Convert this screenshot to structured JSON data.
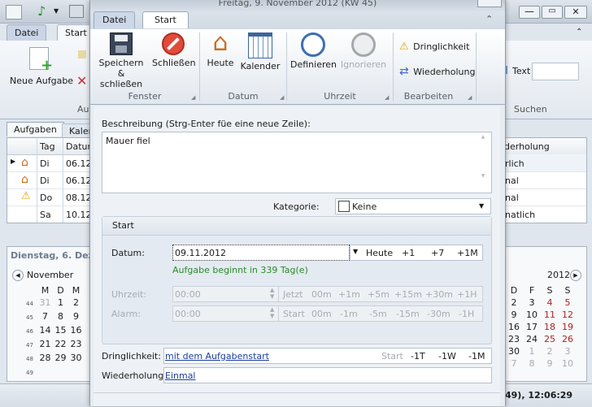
{
  "background": {
    "title_fragment": "",
    "tabs": [
      "Datei",
      "Start"
    ],
    "ribbon": {
      "new_task": "Neue Aufgabe",
      "group_label": "Au",
      "search_text_label": "Text",
      "search_group": "Suchen"
    },
    "task_tabs": [
      "Aufgaben",
      "Kalen"
    ],
    "table_headers": {
      "tag": "Tag",
      "datum": "Datum",
      "wiederholung": "derholung"
    },
    "rows": [
      {
        "tag": "Di",
        "datum": "06.12",
        "wiederholung": "rlich"
      },
      {
        "tag": "Di",
        "datum": "06.12",
        "wiederholung": "nal"
      },
      {
        "tag": "Do",
        "datum": "08.12",
        "wiederholung": "nal"
      },
      {
        "tag": "Sa",
        "datum": "10.12",
        "wiederholung": "natlich"
      }
    ],
    "date_header": "Dienstag, 6. Deze",
    "left_month": "November",
    "left_weekdays": [
      "M",
      "D",
      "M"
    ],
    "left_weeks": [
      {
        "wk": "44",
        "days": [
          "31",
          "1",
          "2"
        ]
      },
      {
        "wk": "45",
        "days": [
          "7",
          "8",
          "9"
        ]
      },
      {
        "wk": "46",
        "days": [
          "14",
          "15",
          "16"
        ]
      },
      {
        "wk": "47",
        "days": [
          "21",
          "22",
          "23"
        ]
      },
      {
        "wk": "48",
        "days": [
          "28",
          "29",
          "30"
        ]
      },
      {
        "wk": "49",
        "days": []
      }
    ],
    "right_year": "2012",
    "right_weekdays": [
      "D",
      "F",
      "S",
      "S"
    ],
    "right_weeks": [
      [
        "2",
        "3",
        "4",
        "5"
      ],
      [
        "9",
        "10",
        "11",
        "12"
      ],
      [
        "16",
        "17",
        "18",
        "19"
      ],
      [
        "23",
        "24",
        "25",
        "26"
      ],
      [
        "30",
        "1",
        "2",
        "3"
      ],
      [
        "7",
        "8",
        "9",
        "10"
      ]
    ],
    "status_text": "49), 12:06:29"
  },
  "window": {
    "title": "Freitag, 9. November 2012 (KW 45)",
    "tabs": [
      "Datei",
      "Start"
    ],
    "active_tab": "Start"
  },
  "ribbon": {
    "groups": [
      {
        "label": "Fenster",
        "buttons": [
          "Speichern &\nschließen",
          "Schließen"
        ]
      },
      {
        "label": "Datum",
        "buttons": [
          "Heute",
          "Kalender"
        ]
      },
      {
        "label": "Uhrzeit",
        "buttons": [
          "Definieren",
          "Ignorieren"
        ]
      },
      {
        "label": "Bearbeiten",
        "buttons": [
          "Dringlichkeit",
          "Wiederholung"
        ]
      }
    ]
  },
  "form": {
    "description_label": "Beschreibung (Strg-Enter füe eine neue Zeile):",
    "description_value": "Mauer fiel",
    "category_label": "Kategorie:",
    "category_value": "Keine",
    "start_section": "Start",
    "date_label": "Datum:",
    "date_value": "09.11.2012",
    "date_buttons": [
      "Heute",
      "+1",
      "+7",
      "+1M"
    ],
    "date_info": "Aufgabe beginnt in 339 Tag(e)",
    "time_label": "Uhrzeit:",
    "time_value": "00:00",
    "time_buttons": [
      "Jetzt",
      "00m",
      "+1m",
      "+5m",
      "+15m",
      "+30m",
      "+1H"
    ],
    "alarm_label": "Alarm:",
    "alarm_value": "00:00",
    "alarm_buttons": [
      "Start",
      "00m",
      "-1m",
      "-5m",
      "-15m",
      "-30m",
      "-1H"
    ],
    "urgency_label": "Dringlichkeit:",
    "urgency_value": "mit dem Aufgabenstart",
    "urgency_buttons": [
      "Start",
      "-1T",
      "-1W",
      "-1M"
    ],
    "repeat_label": "Wiederholung:",
    "repeat_value": "Einmal"
  },
  "colors": {
    "accent_green": "#2a8a2a",
    "link_blue": "#1a3e9b",
    "weekend_red": "#b02020"
  }
}
